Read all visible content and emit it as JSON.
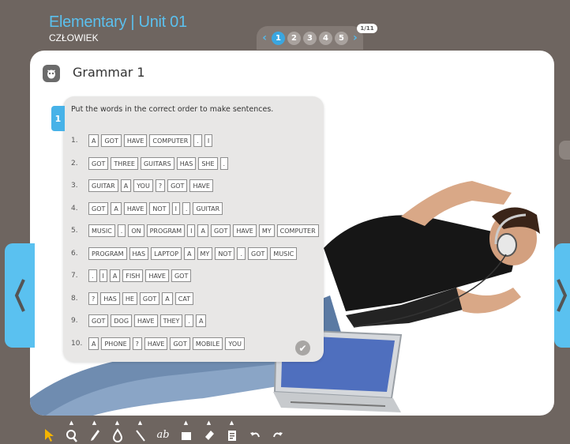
{
  "header": {
    "title": "Elementary | Unit 01",
    "subtitle": "CZŁOWIEK"
  },
  "pager": {
    "prev": "‹",
    "next": "›",
    "pages": [
      "1",
      "2",
      "3",
      "4",
      "5"
    ],
    "active_page": "1",
    "count": "1/11"
  },
  "stage": {
    "title": "Grammar 1",
    "exercise_number": "1",
    "instruction": "Put the words in the correct order to make sentences.",
    "sentences": [
      {
        "num": "1.",
        "words": [
          "A",
          "GOT",
          "HAVE",
          "COMPUTER",
          ".",
          "I"
        ]
      },
      {
        "num": "2.",
        "words": [
          "GOT",
          "THREE",
          "GUITARS",
          "HAS",
          "SHE",
          "."
        ]
      },
      {
        "num": "3.",
        "words": [
          "GUITAR",
          "A",
          "YOU",
          "?",
          "GOT",
          "HAVE"
        ]
      },
      {
        "num": "4.",
        "words": [
          "GOT",
          "A",
          "HAVE",
          "NOT",
          "I",
          ".",
          "GUITAR"
        ]
      },
      {
        "num": "5.",
        "words": [
          "MUSIC",
          ".",
          "ON",
          "PROGRAM",
          "I",
          "A",
          "GOT",
          "HAVE",
          "MY",
          "COMPUTER"
        ]
      },
      {
        "num": "6.",
        "words": [
          "PROGRAM",
          "HAS",
          "LAPTOP",
          "A",
          "MY",
          "NOT",
          ".",
          "GOT",
          "MUSIC"
        ]
      },
      {
        "num": "7.",
        "words": [
          ".",
          "I",
          "A",
          "FISH",
          "HAVE",
          "GOT"
        ]
      },
      {
        "num": "8.",
        "words": [
          "?",
          "HAS",
          "HE",
          "GOT",
          "A",
          "CAT"
        ]
      },
      {
        "num": "9.",
        "words": [
          "GOT",
          "DOG",
          "HAVE",
          "THEY",
          ".",
          "A"
        ]
      },
      {
        "num": "10.",
        "words": [
          "A",
          "PHONE",
          "?",
          "HAVE",
          "GOT",
          "MOBILE",
          "YOU"
        ]
      }
    ]
  },
  "toolbar": {
    "tools": [
      "pointer-icon",
      "zoom-icon",
      "pen-icon",
      "ink-icon",
      "line-icon",
      "text-icon",
      "rectangle-icon",
      "eraser-icon",
      "clipboard-icon",
      "undo-icon",
      "redo-icon"
    ],
    "text_tool_label": "ab"
  },
  "colors": {
    "accent": "#47b2e8",
    "background": "#6e6560",
    "title": "#5bc0ee"
  }
}
